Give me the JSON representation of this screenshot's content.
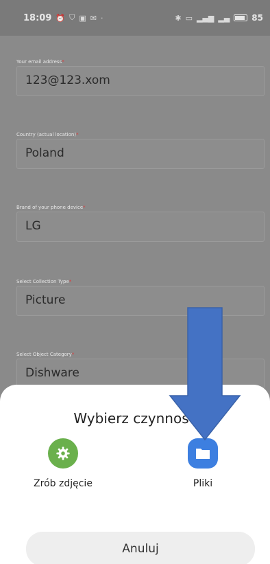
{
  "status_bar": {
    "time": "18:09",
    "battery_percent": "85"
  },
  "form": {
    "fields": [
      {
        "label": "Your email address",
        "value": "123@123.xom"
      },
      {
        "label": "Country (actual location)",
        "value": "Poland"
      },
      {
        "label": "Brand of your phone device",
        "value": "LG"
      },
      {
        "label": "Select Collection Type",
        "value": "Picture"
      },
      {
        "label": "Select Object Category",
        "value": "Dishware"
      }
    ],
    "required_mark": "*"
  },
  "sheet": {
    "title": "Wybierz czynność",
    "options": [
      {
        "label": "Zrób zdjęcie",
        "icon": "camera-gear-icon",
        "color": "#6ab04c"
      },
      {
        "label": "Pliki",
        "icon": "folder-icon",
        "color": "#3d7fe0"
      }
    ],
    "cancel_label": "Anuluj"
  },
  "overlay": {
    "arrow_icon": "down-arrow-annotation",
    "arrow_color": "#4472c4"
  }
}
